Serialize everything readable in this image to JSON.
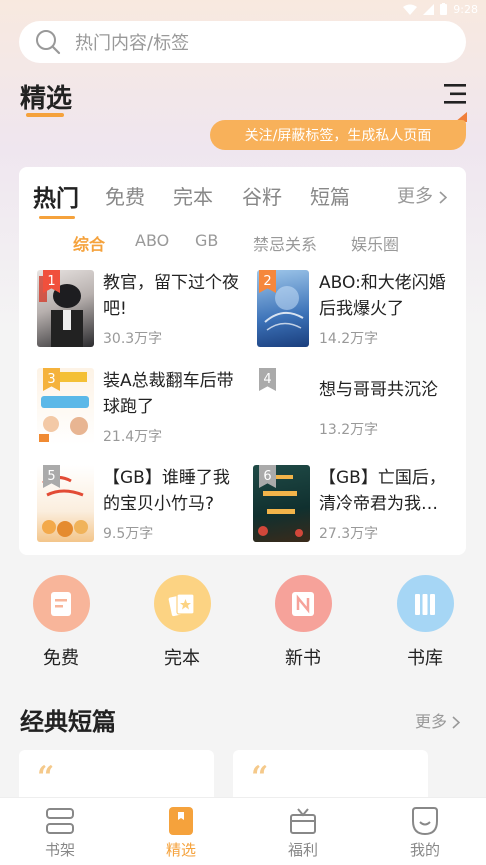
{
  "status_bar": {
    "time": "9:28"
  },
  "search": {
    "placeholder": "热门内容/标签"
  },
  "header": {
    "title": "精选",
    "tip": "关注/屏蔽标签，生成私人页面"
  },
  "tabs": [
    {
      "label": "热门",
      "active": true
    },
    {
      "label": "免费"
    },
    {
      "label": "完本"
    },
    {
      "label": "谷籽"
    },
    {
      "label": "短篇"
    }
  ],
  "tabs_more": "更多",
  "subtabs": [
    {
      "label": "综合",
      "active": true
    },
    {
      "label": "ABO"
    },
    {
      "label": "GB"
    },
    {
      "label": "禁忌关系"
    },
    {
      "label": "娱乐圈"
    }
  ],
  "books": [
    {
      "rank": "1",
      "title": "教官，留下过个夜吧!",
      "count": "30.3万字",
      "rank_color": "#f0503c"
    },
    {
      "rank": "2",
      "title": "ABO:和大佬闪婚后我爆火了",
      "count": "14.2万字",
      "rank_color": "#f5873c"
    },
    {
      "rank": "3",
      "title": "装A总裁翻车后带球跑了",
      "count": "21.4万字",
      "rank_color": "#f5b23c"
    },
    {
      "rank": "4",
      "title": "想与哥哥共沉沦",
      "count": "13.2万字",
      "rank_color": "#aaaaaa"
    },
    {
      "rank": "5",
      "title": "【GB】谁睡了我的宝贝小竹马?",
      "count": "9.5万字",
      "rank_color": "#aaaaaa"
    },
    {
      "rank": "6",
      "title": "【GB】亡国后，清冷帝君为我…",
      "count": "27.3万字",
      "rank_color": "#aaaaaa"
    }
  ],
  "categories": [
    {
      "label": "免费",
      "color": "#f8b59a",
      "icon": "document-icon"
    },
    {
      "label": "完本",
      "color": "#fcd383",
      "icon": "cards-icon"
    },
    {
      "label": "新书",
      "color": "#f6a29a",
      "icon": "new-book-icon"
    },
    {
      "label": "书库",
      "color": "#a6d6f5",
      "icon": "bookshelf-icon"
    }
  ],
  "section": {
    "title": "经典短篇",
    "more": "更多"
  },
  "short_cards": [
    {
      "quote": "“"
    },
    {
      "quote": "“"
    }
  ],
  "bottom_nav": [
    {
      "label": "书架",
      "icon": "bookshelf-icon"
    },
    {
      "label": "精选",
      "icon": "bookmark-icon",
      "active": true
    },
    {
      "label": "福利",
      "icon": "gift-icon"
    },
    {
      "label": "我的",
      "icon": "profile-icon"
    }
  ],
  "colors": {
    "accent": "#f5a23c",
    "tip_bg": "#f8b15a"
  }
}
